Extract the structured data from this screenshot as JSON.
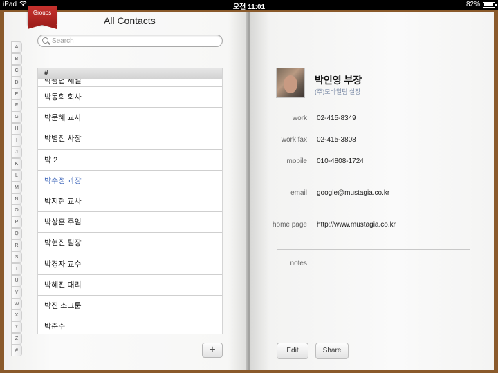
{
  "status": {
    "device": "iPad",
    "time": "오전 11:01",
    "battery": "82%",
    "battery_level": 0.82
  },
  "groups_label": "Groups",
  "title": "All Contacts",
  "search": {
    "placeholder": "Search"
  },
  "index": [
    "A",
    "B",
    "C",
    "D",
    "E",
    "F",
    "G",
    "H",
    "I",
    "J",
    "K",
    "L",
    "M",
    "N",
    "O",
    "P",
    "Q",
    "R",
    "S",
    "T",
    "U",
    "V",
    "W",
    "X",
    "Y",
    "Z",
    "#"
  ],
  "list": {
    "header": "#",
    "rows": [
      {
        "name": "박광협 세일"
      },
      {
        "name": "박동희 회사"
      },
      {
        "name": "박문혜 교사"
      },
      {
        "name": "박병진 사장"
      },
      {
        "name": "박 2"
      },
      {
        "name": "박수정 과장"
      },
      {
        "name": "박지현 교사"
      },
      {
        "name": "박상훈 주임"
      },
      {
        "name": "박현진 팀장"
      },
      {
        "name": "박경자 교수"
      },
      {
        "name": "박혜진 대리"
      },
      {
        "name": "박진 소그룹"
      },
      {
        "name": "박준수"
      }
    ],
    "selected_index": 5
  },
  "add_label": "+",
  "contact": {
    "name": "박인영 부장",
    "company": "(주)모바일팀 실장",
    "fields": [
      {
        "label": "work",
        "value": "02-415-8349"
      },
      {
        "label": "work fax",
        "value": "02-415-3808"
      },
      {
        "label": "mobile",
        "value": "010-4808-1724"
      },
      {
        "label": "email",
        "value": "google@mustagia.co.kr"
      },
      {
        "label": "home page",
        "value": "http://www.mustagia.co.kr"
      }
    ],
    "notes_label": "notes"
  },
  "buttons": {
    "edit": "Edit",
    "share": "Share"
  }
}
